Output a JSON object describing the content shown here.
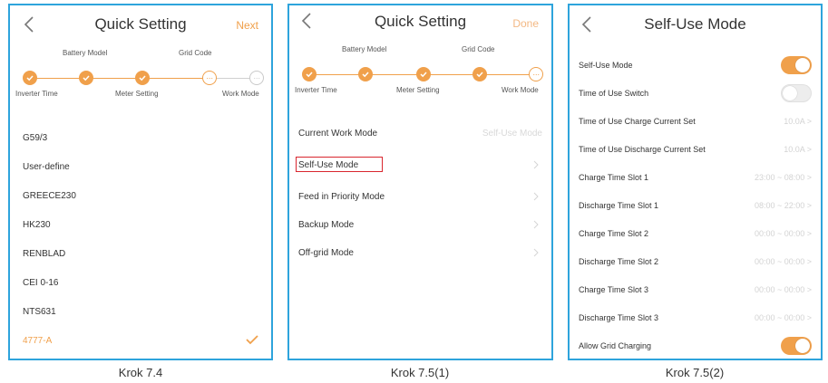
{
  "panel1": {
    "title": "Quick Setting",
    "action": "Next",
    "steps_top": [
      "Battery Model",
      "Grid Code"
    ],
    "steps_bottom": [
      "Inverter Time",
      "Meter Setting",
      "Work Mode"
    ],
    "grid_codes": [
      "G59/3",
      "User-define",
      "GREECE230",
      "HK230",
      "RENBLAD",
      "CEI 0-16",
      "NTS631",
      "4777-A"
    ],
    "selected": "4777-A",
    "caption": "Krok 7.4"
  },
  "panel2": {
    "title": "Quick Setting",
    "action": "Done",
    "steps_top": [
      "Battery Model",
      "Grid Code"
    ],
    "steps_bottom": [
      "Inverter Time",
      "Meter Setting",
      "Work Mode"
    ],
    "current_mode_label": "Current Work Mode",
    "current_mode_value": "Self-Use Mode",
    "modes": [
      "Self-Use Mode",
      "Feed in Priority Mode",
      "Backup Mode",
      "Off-grid Mode"
    ],
    "caption": "Krok 7.5(1)"
  },
  "panel3": {
    "title": "Self-Use Mode",
    "rows": [
      {
        "label": "Self-Use Mode",
        "toggle": "on"
      },
      {
        "label": "Time of Use Switch",
        "toggle": "off"
      },
      {
        "label": "Time of Use Charge Current Set",
        "value": "10.0A >"
      },
      {
        "label": "Time of Use Discharge Current Set",
        "value": "10.0A >"
      },
      {
        "label": "Charge Time Slot 1",
        "value": "23:00 ~ 08:00 >"
      },
      {
        "label": "Discharge Time Slot 1",
        "value": "08:00 ~ 22:00 >"
      },
      {
        "label": "Charge Time Slot 2",
        "value": "00:00 ~ 00:00 >"
      },
      {
        "label": "Discharge Time Slot 2",
        "value": "00:00 ~ 00:00 >"
      },
      {
        "label": "Charge Time Slot 3",
        "value": "00:00 ~ 00:00 >"
      },
      {
        "label": "Discharge Time Slot 3",
        "value": "00:00 ~ 00:00 >"
      },
      {
        "label": "Allow Grid Charging",
        "toggle": "on"
      }
    ],
    "caption": "Krok 7.5(2)"
  },
  "colors": {
    "accent": "#f0a04b",
    "frame": "#2ea4dc",
    "highlight": "#d9262e"
  }
}
